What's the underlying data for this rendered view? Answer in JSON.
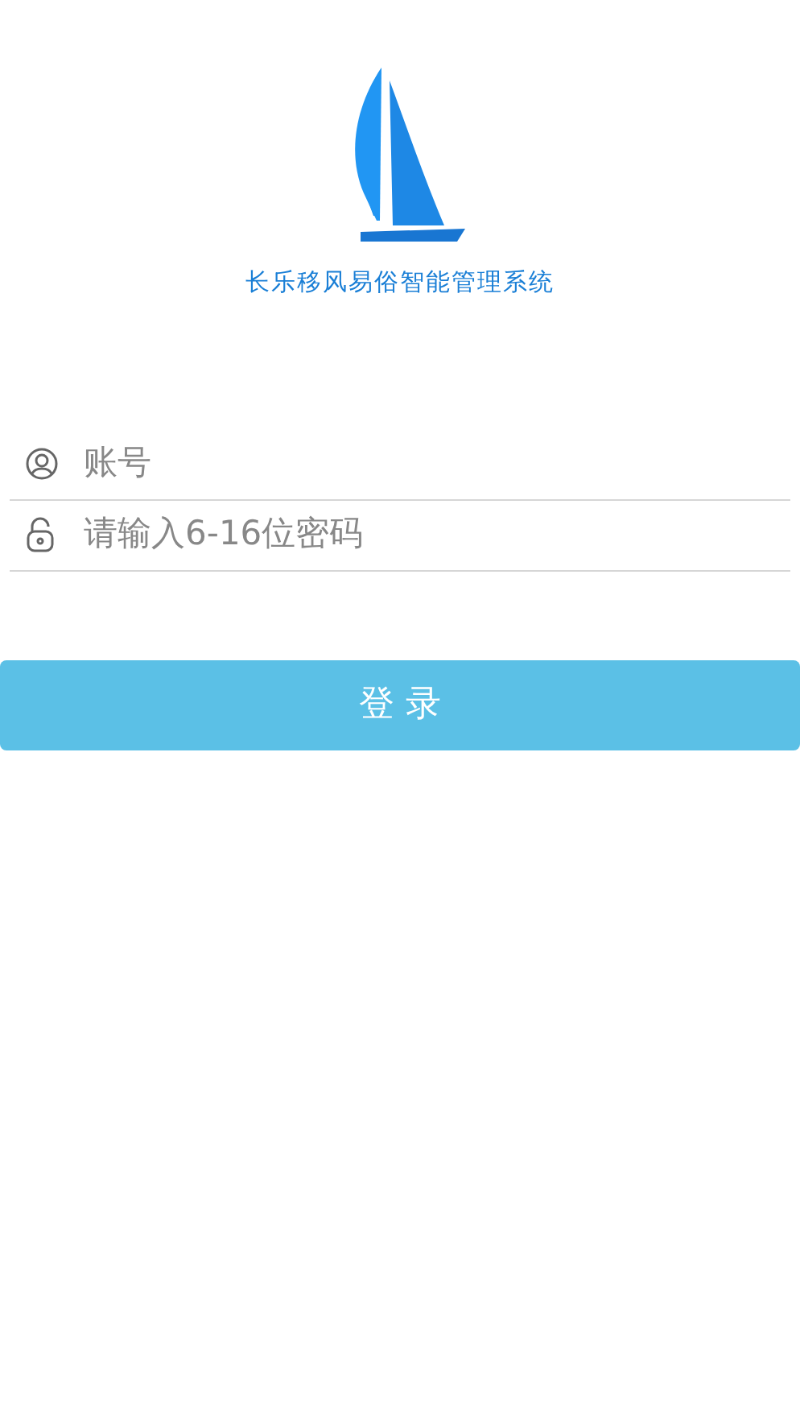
{
  "logo": {
    "title": "长乐移风易俗智能管理系统"
  },
  "fields": [
    {
      "kind": "account",
      "placeholder": "账号"
    },
    {
      "kind": "password",
      "placeholder": "请输入6-16位密码"
    }
  ],
  "login_button": {
    "label": "登 录"
  }
}
